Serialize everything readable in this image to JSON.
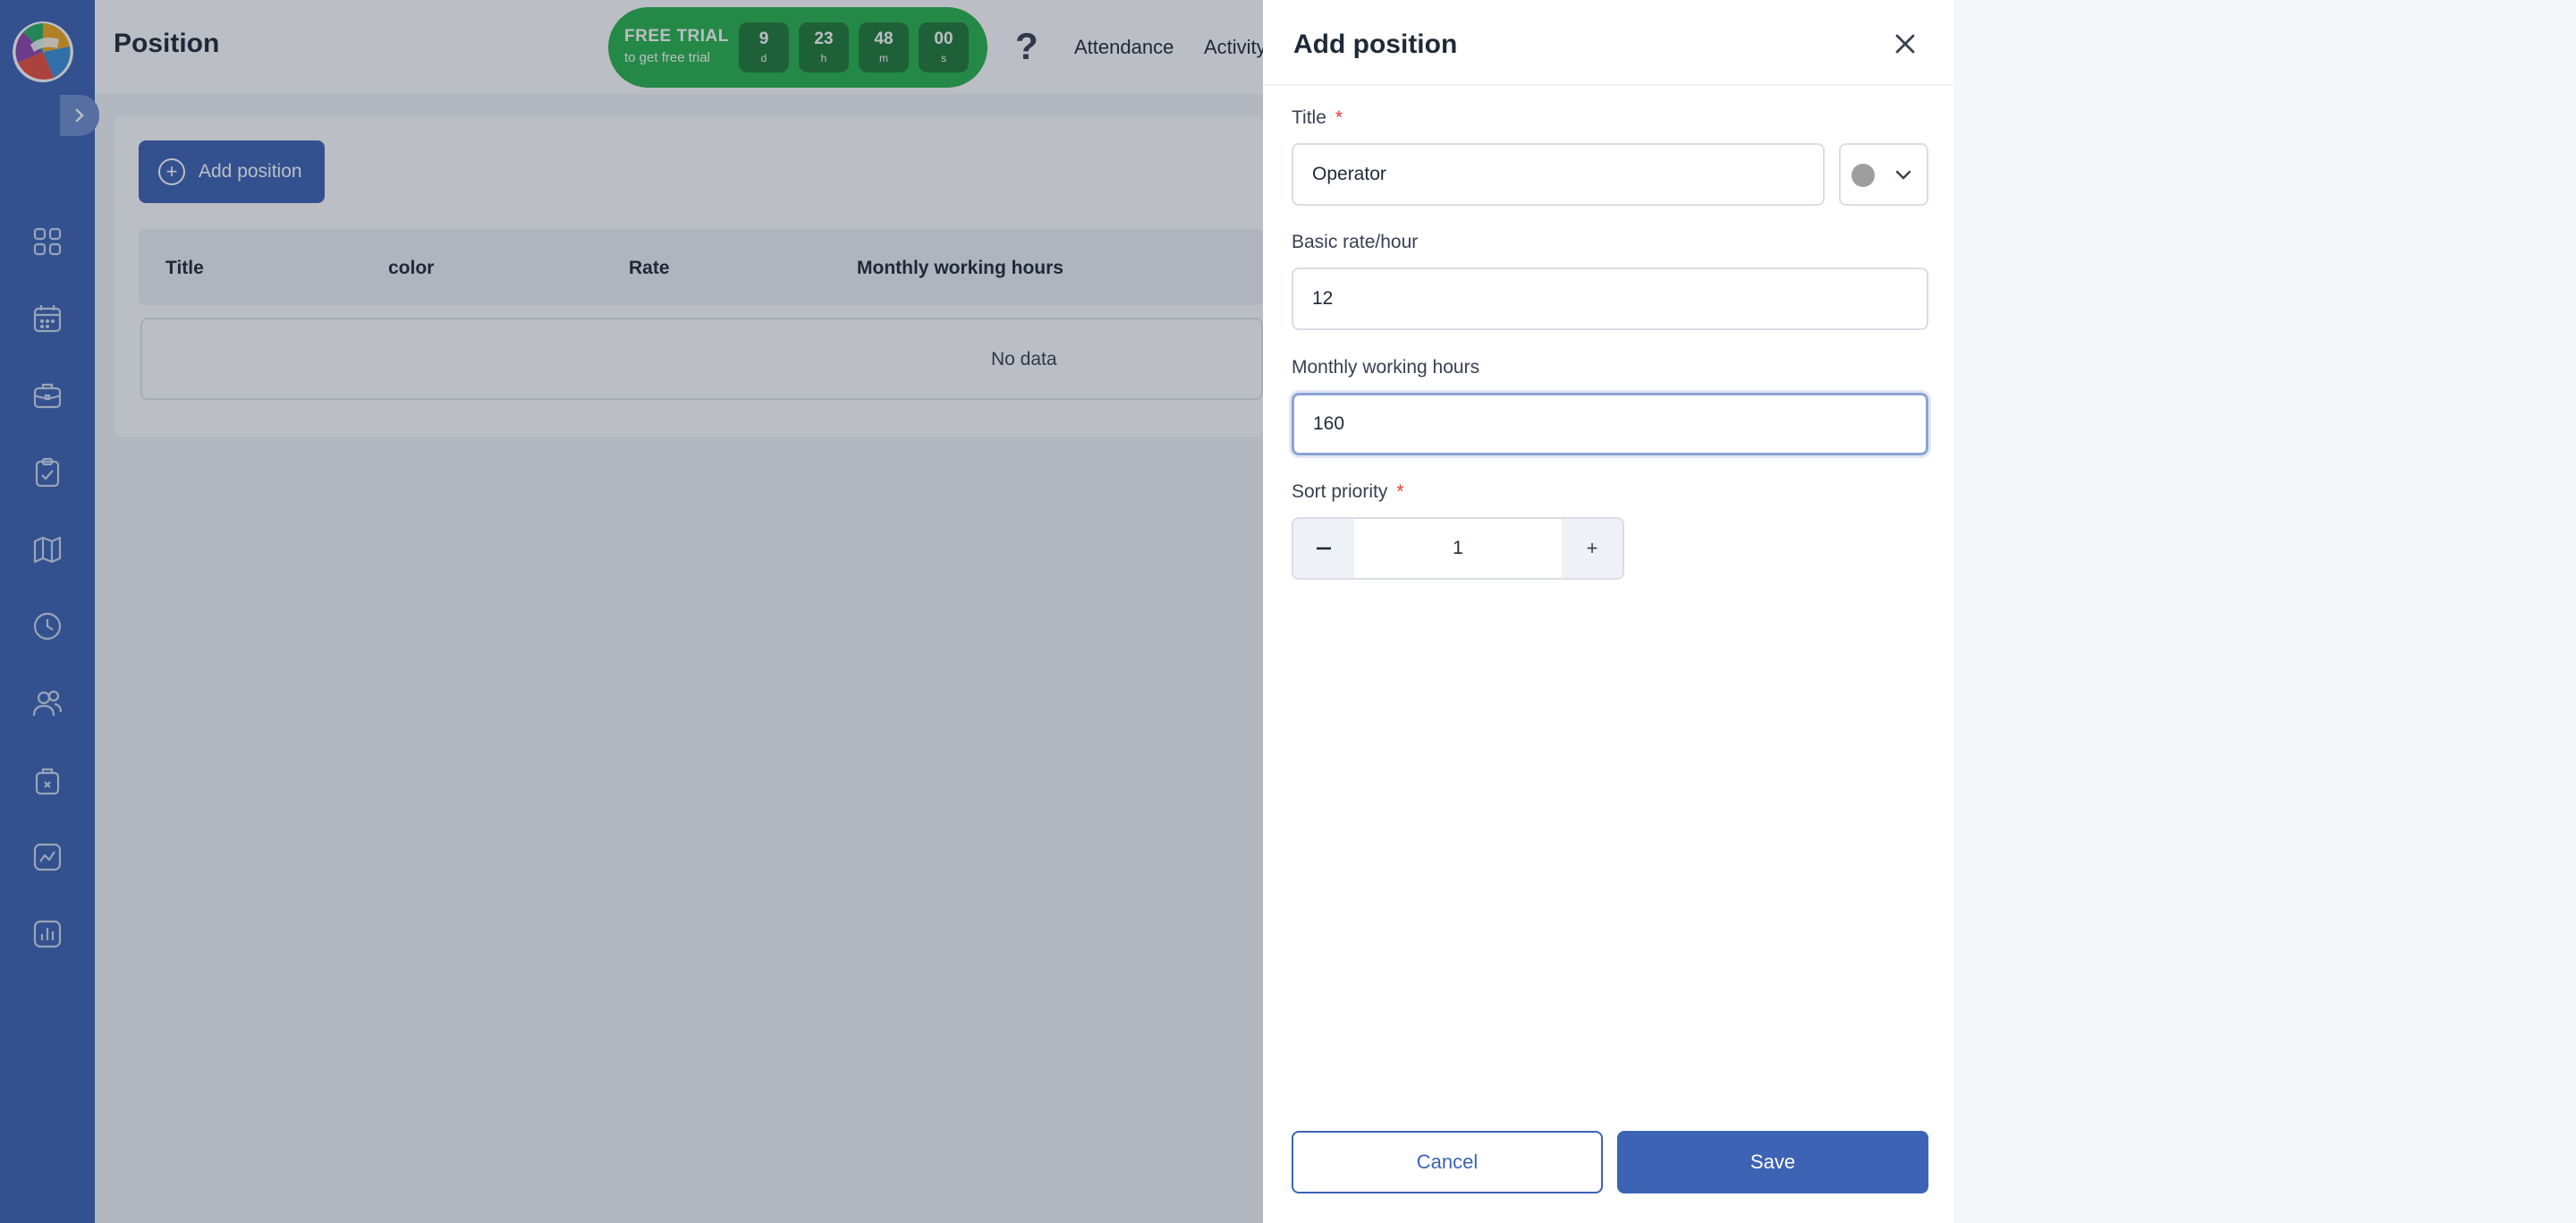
{
  "app": {
    "page_title": "Position"
  },
  "trial": {
    "title": "FREE TRIAL",
    "subtitle": "to get free trial",
    "countdown": [
      {
        "value": "9",
        "unit": "d"
      },
      {
        "value": "23",
        "unit": "h"
      },
      {
        "value": "48",
        "unit": "m"
      },
      {
        "value": "00",
        "unit": "s"
      }
    ],
    "color": "#27b34b"
  },
  "header": {
    "help_icon": "?",
    "links": [
      "Attendance",
      "Activity"
    ]
  },
  "sidebar": {
    "icons": [
      "dashboard-icon",
      "calendar-icon",
      "briefcase-icon",
      "clipboard-icon",
      "map-icon",
      "clock-icon",
      "users-icon",
      "bag-icon",
      "chart-icon",
      "report-icon"
    ],
    "accent": "#3d63b4"
  },
  "content": {
    "add_button_label": "Add position",
    "columns": [
      "Title",
      "color",
      "Rate",
      "Monthly working hours"
    ],
    "empty_text": "No data"
  },
  "drawer": {
    "title": "Add position",
    "fields": {
      "title": {
        "label": "Title",
        "required": "*",
        "value": "Operator"
      },
      "color": {
        "value": "#9e9e9e"
      },
      "rate": {
        "label": "Basic rate/hour",
        "value": "12"
      },
      "hours": {
        "label": "Monthly working hours",
        "value": "160"
      },
      "sort": {
        "label": "Sort priority",
        "required": "*",
        "value": "1",
        "plus": "+"
      }
    },
    "cancel_label": "Cancel",
    "save_label": "Save"
  }
}
